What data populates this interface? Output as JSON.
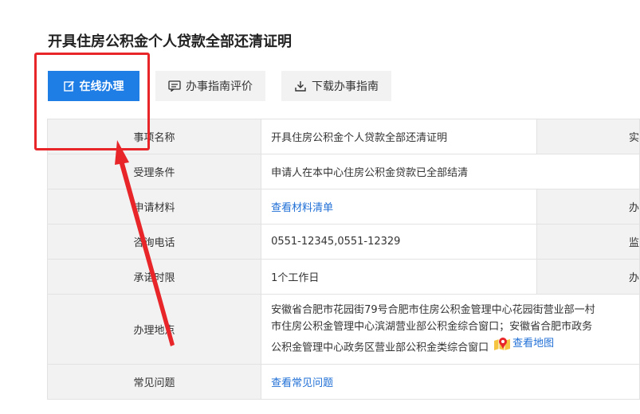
{
  "page": {
    "title": "开具住房公积金个人贷款全部还清证明"
  },
  "toolbar": {
    "online_label": "在线办理",
    "evaluate_label": "办事指南评价",
    "download_label": "下载办事指南"
  },
  "table": {
    "rows": [
      {
        "label": "事项名称",
        "value": "开具住房公积金个人贷款全部还清证明",
        "extra": "实"
      },
      {
        "label": "受理条件",
        "value": "申请人在本中心住房公积金贷款已全部结清"
      },
      {
        "label": "申请材料",
        "value": "查看材料清单",
        "extra": "办"
      },
      {
        "label": "咨询电话",
        "value": "0551-12345,0551-12329",
        "extra": "监"
      },
      {
        "label": "承诺时限",
        "value": "1个工作日",
        "extra": "办"
      },
      {
        "label": "办理地点",
        "address_lines": [
          "安徽省合肥市花园街79号合肥市住房公积金管理中心花园街营业部一村",
          "市住房公积金管理中心滨湖营业部公积金综合窗口；安徽省合肥市政务",
          "公积金管理中心政务区营业部公积金类综合窗口"
        ],
        "map_link": "查看地图"
      },
      {
        "label": "常见问题",
        "value": "查看常见问题"
      }
    ]
  },
  "colors": {
    "primary": "#1f7de6",
    "link": "#1f6fd6",
    "annotation": "#e8262a",
    "label_bg": "#f2f2f2"
  },
  "icons": {
    "online": "edit-icon",
    "evaluate": "comment-icon",
    "download": "download-icon",
    "map": "map-pin-icon"
  }
}
